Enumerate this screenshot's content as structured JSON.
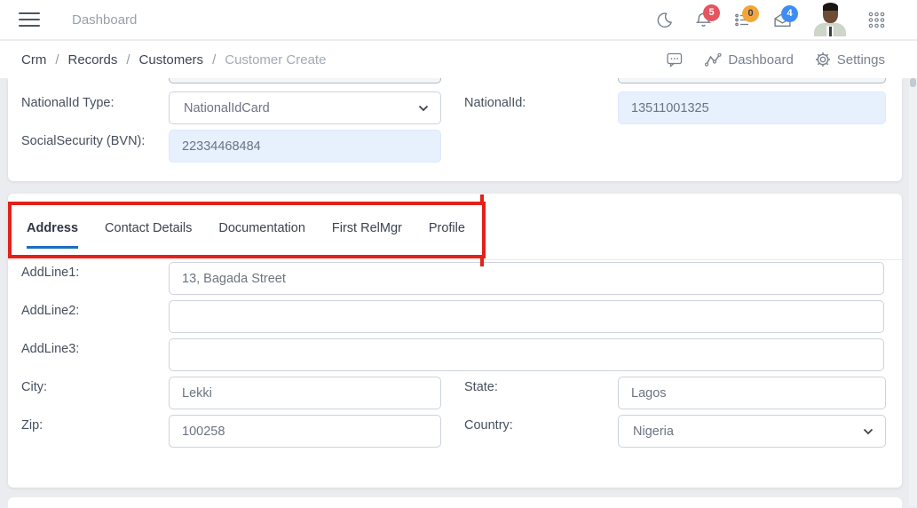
{
  "navbar": {
    "title": "Dashboard",
    "notif_count": "5",
    "task_count": "0",
    "mail_count": "4"
  },
  "breadcrumb": {
    "sep": "/",
    "items": [
      "Crm",
      "Records",
      "Customers",
      "Customer Create"
    ],
    "dashboard_label": "Dashboard",
    "settings_label": "Settings"
  },
  "identity": {
    "nationalid_type_label": "NationalId Type:",
    "nationalid_type_value": "NationalIdCard",
    "nationalid_label": "NationalId:",
    "nationalid_value": "13511001325",
    "bvn_label": "SocialSecurity (BVN):",
    "bvn_value": "22334468484"
  },
  "tabs": {
    "items": [
      "Address",
      "Contact Details",
      "Documentation",
      "First RelMgr",
      "Profile"
    ],
    "active": "Address"
  },
  "address": {
    "addline1_label": "AddLine1:",
    "addline1_value": "13, Bagada Street",
    "addline2_label": "AddLine2:",
    "addline2_value": "",
    "addline3_label": "AddLine3:",
    "addline3_value": "",
    "city_label": "City:",
    "city_value": "Lekki",
    "state_label": "State:",
    "state_value": "Lagos",
    "zip_label": "Zip:",
    "zip_value": "100258",
    "country_label": "Country:",
    "country_value": "Nigeria"
  },
  "colors": {
    "accent": "#1a6fc0",
    "annotation_red": "#e2211a",
    "badge_red": "#e45560",
    "badge_yellow": "#f2a63a",
    "badge_blue": "#3f8cf3",
    "filled_input_bg": "#e7f0fd"
  }
}
